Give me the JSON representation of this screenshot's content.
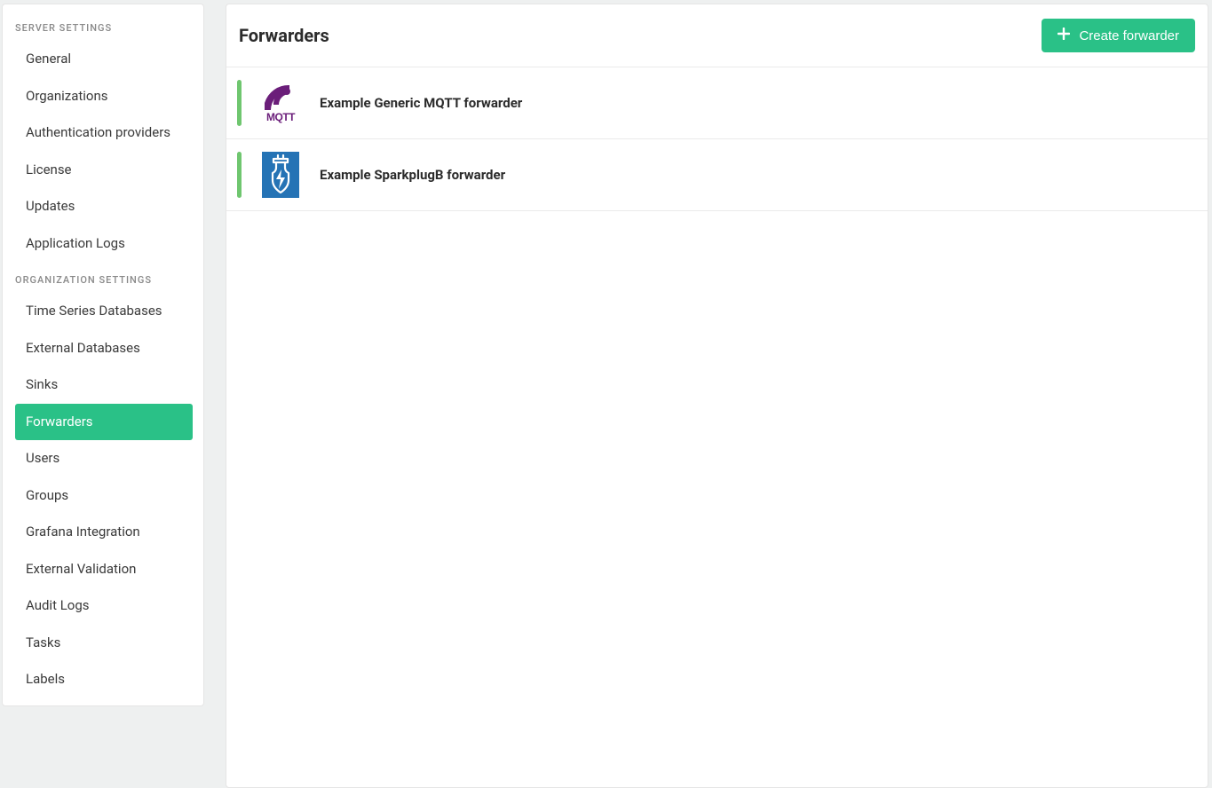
{
  "sidebar": {
    "section1_title": "SERVER SETTINGS",
    "section1_items": [
      {
        "label": "General"
      },
      {
        "label": "Organizations"
      },
      {
        "label": "Authentication providers"
      },
      {
        "label": "License"
      },
      {
        "label": "Updates"
      },
      {
        "label": "Application Logs"
      }
    ],
    "section2_title": "ORGANIZATION SETTINGS",
    "section2_items": [
      {
        "label": "Time Series Databases"
      },
      {
        "label": "External Databases"
      },
      {
        "label": "Sinks"
      },
      {
        "label": "Forwarders",
        "active": true
      },
      {
        "label": "Users"
      },
      {
        "label": "Groups"
      },
      {
        "label": "Grafana Integration"
      },
      {
        "label": "External Validation"
      },
      {
        "label": "Audit Logs"
      },
      {
        "label": "Tasks"
      },
      {
        "label": "Labels"
      }
    ]
  },
  "header": {
    "title": "Forwarders",
    "create_label": "Create forwarder"
  },
  "forwarders": [
    {
      "name": "Example Generic MQTT forwarder",
      "icon": "mqtt"
    },
    {
      "name": "Example SparkplugB forwarder",
      "icon": "sparkplug"
    }
  ],
  "colors": {
    "accent": "#2ac187",
    "status_ok": "#6fc66f",
    "mqtt_purple": "#6b1e7a",
    "sparkplug_blue": "#2573b5"
  }
}
